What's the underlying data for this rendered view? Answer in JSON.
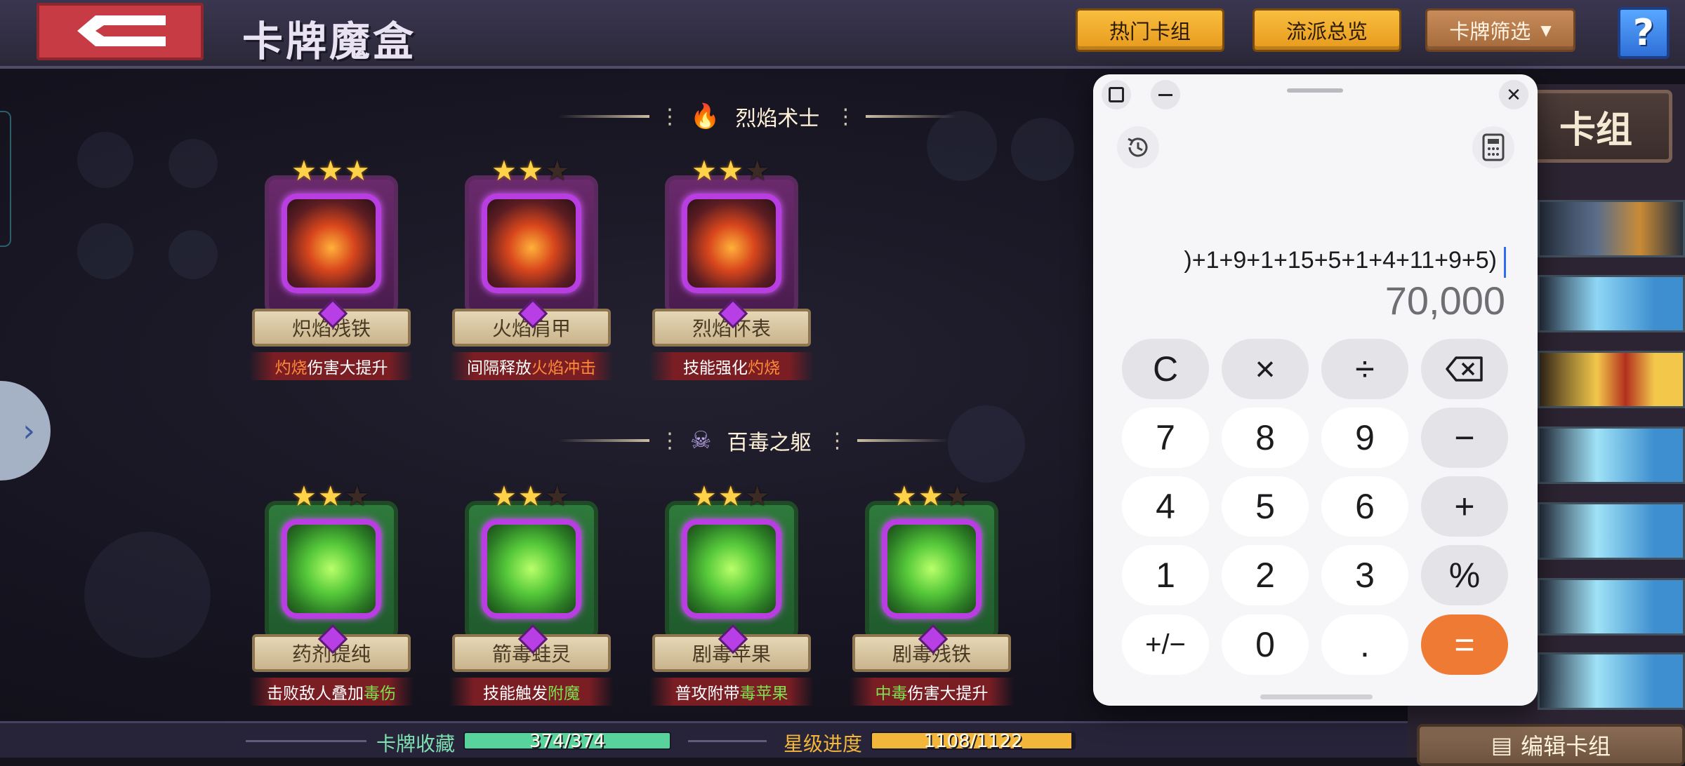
{
  "app": {
    "title": "卡牌魔盒",
    "back_icon": "back-arrow-icon",
    "buttons": {
      "hot_decks": "热门卡组",
      "school_overview": "流派总览",
      "card_filter": "卡牌筛选",
      "help": "?"
    }
  },
  "sections": [
    {
      "title": "烈焰术士",
      "icon": "fire-icon",
      "cards": [
        {
          "name": "炽焰残铁",
          "stars": 3,
          "desc": [
            {
              "t": "灼烧",
              "hl": "fire"
            },
            {
              "t": "伤害大提升",
              "hl": ""
            }
          ]
        },
        {
          "name": "火焰肩甲",
          "stars": 2,
          "desc": [
            {
              "t": "间隔释放",
              "hl": ""
            },
            {
              "t": "火焰冲击",
              "hl": "fire"
            }
          ]
        },
        {
          "name": "烈焰怀表",
          "stars": 2,
          "desc": [
            {
              "t": "技能强化",
              "hl": ""
            },
            {
              "t": "灼烧",
              "hl": "fire"
            }
          ]
        }
      ]
    },
    {
      "title": "百毒之躯",
      "icon": "poison-skull-icon",
      "cards": [
        {
          "name": "药剂提纯",
          "stars": 2,
          "desc": [
            {
              "t": "击败敌人叠加",
              "hl": ""
            },
            {
              "t": "毒伤",
              "hl": "poison"
            }
          ]
        },
        {
          "name": "箭毒蛙灵",
          "stars": 2,
          "desc": [
            {
              "t": "技能触发",
              "hl": ""
            },
            {
              "t": "附魔",
              "hl": "poison"
            }
          ]
        },
        {
          "name": "剧毒苹果",
          "stars": 2,
          "desc": [
            {
              "t": "普攻附带",
              "hl": ""
            },
            {
              "t": "毒苹果",
              "hl": "poison"
            }
          ]
        },
        {
          "name": "剧毒残铁",
          "stars": 2,
          "desc": [
            {
              "t": "中毒",
              "hl": "poison"
            },
            {
              "t": "伤害大提升",
              "hl": ""
            }
          ]
        }
      ]
    }
  ],
  "right_panel": {
    "deck_title": "卡组",
    "edit_deck_label": "编辑卡组"
  },
  "bottom": {
    "collection_label": "卡牌收藏",
    "collection_value": "374/374",
    "collection_fraction": 1.0,
    "star_label": "星级进度",
    "star_value": "1108/1122",
    "star_fraction": 0.9875
  },
  "calculator": {
    "expression": ")+1+9+1+15+5+1+4+11+9+5)",
    "result": "70,000",
    "keys": [
      [
        "C",
        "×",
        "÷",
        "⌫"
      ],
      [
        "7",
        "8",
        "9",
        "−"
      ],
      [
        "4",
        "5",
        "6",
        "+"
      ],
      [
        "1",
        "2",
        "3",
        "%"
      ],
      [
        "+/−",
        "0",
        ".",
        "="
      ]
    ]
  },
  "colors": {
    "fire_highlight": "#ff8a3a",
    "poison_highlight": "#7ee04e",
    "equals_key": "#ef7a33",
    "collection_bar": "#57d39b",
    "star_bar": "#f2b63a"
  }
}
